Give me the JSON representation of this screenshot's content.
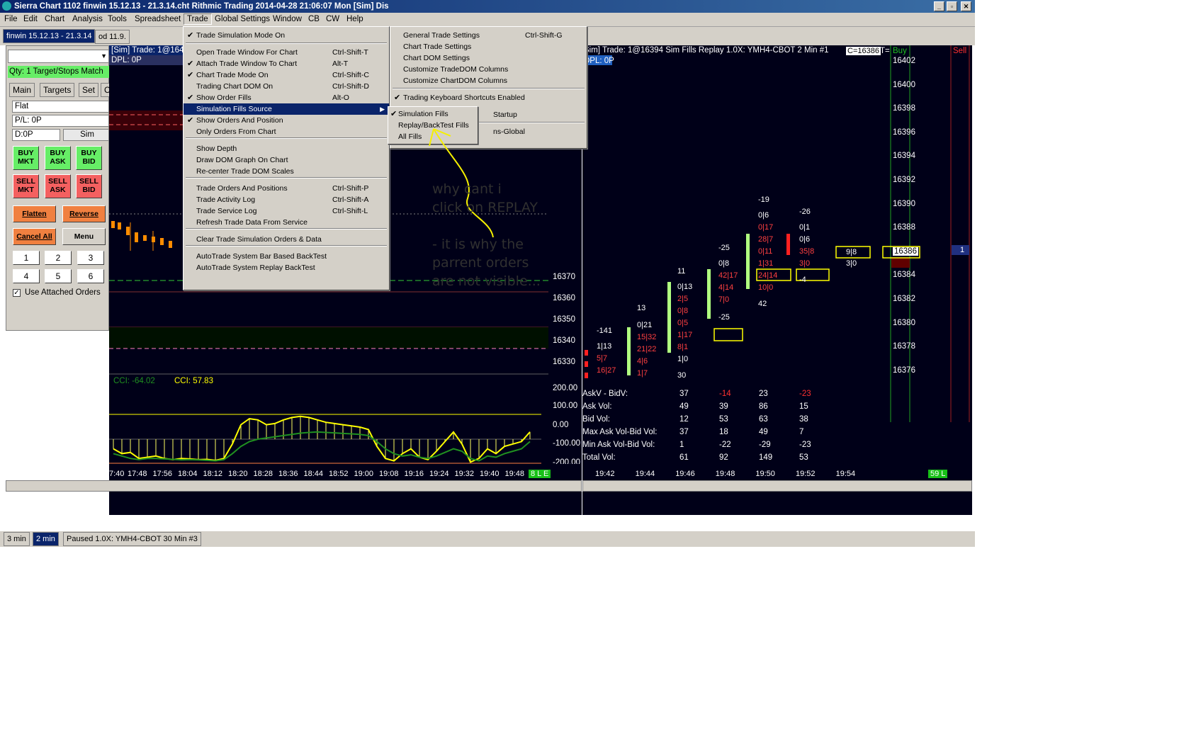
{
  "window": {
    "title": "Sierra Chart 1102 finwin 15.12.13 - 21.3.14.cht  Rithmic Trading 2014-04-28  21:06:07 Mon [Sim]  Dis"
  },
  "menubar": [
    "File",
    "Edit",
    "Chart",
    "Analysis",
    "Tools",
    "Spreadsheet",
    "Trade",
    "Global Settings",
    "Window",
    "CB",
    "CW",
    "Help"
  ],
  "tabs": {
    "chartbook": "finwin 15.12.13 - 21.3.14",
    "second": "od 11.9."
  },
  "trade_window": {
    "qty_label": "Qty: 1 Target/Stops Match",
    "tabs": [
      "Main",
      "Targets",
      "Set",
      "C"
    ],
    "position": "Flat",
    "pl": "P/L: 0P",
    "dpl": "D:0P",
    "mode": "Sim",
    "buy_mkt": "BUY MKT",
    "buy_ask": "BUY ASK",
    "buy_bid": "BUY BID",
    "sell_mkt": "SELL MKT",
    "sell_ask": "SELL ASK",
    "sell_bid": "SELL BID",
    "flatten": "Flatten",
    "reverse": "Reverse",
    "cancel_all": "Cancel All",
    "menu": "Menu",
    "numbers": [
      "1",
      "2",
      "3",
      "4",
      "5",
      "6"
    ],
    "use_attached": "Use Attached Orders"
  },
  "chart1": {
    "header": "[Sim]  Trade: 1@164",
    "dpl": "DPL: 0P",
    "prices": [
      "16370",
      "16360",
      "16350",
      "16340",
      "16330"
    ],
    "cci_label1": "CCI: -64.02",
    "cci_label2": "CCI: 57.83",
    "cci_scale": [
      "200.00",
      "100.00",
      "0.00",
      "-100.00",
      "-200.00"
    ],
    "times": [
      "7:40",
      "17:48",
      "17:56",
      "18:04",
      "18:12",
      "18:20",
      "18:28",
      "18:36",
      "18:44",
      "18:52",
      "19:00",
      "19:08",
      "19:16",
      "19:24",
      "19:32",
      "19:40",
      "19:48"
    ],
    "badge": "8 L E"
  },
  "chart2": {
    "header": "Sim]  Trade: 1@16394  Sim Fills   Replay 1.0X: YMH4-CBOT  2 Min    #1",
    "cbox": "C=16386",
    "t": "T=",
    "buy": "Buy",
    "sell": "Sell",
    "dpl": "DPL: 0P",
    "prices": [
      "16402",
      "16400",
      "16398",
      "16396",
      "16394",
      "16392",
      "16390",
      "16388",
      "16386",
      "16384",
      "16382",
      "16380",
      "16378",
      "16376"
    ],
    "current_price": "16386",
    "sell_qty": "1",
    "stats_labels": [
      "AskV - BidV:",
      "Ask Vol:",
      "Bid Vol:",
      "Max Ask Vol-Bid Vol:",
      "Min Ask Vol-Bid Vol:",
      "Total Vol:"
    ],
    "stats": [
      [
        "37",
        "49",
        "12",
        "37",
        "1",
        "61"
      ],
      [
        "-14",
        "39",
        "53",
        "18",
        "-22",
        "92"
      ],
      [
        "23",
        "86",
        "63",
        "49",
        "-29",
        "149"
      ],
      [
        "-23",
        "15",
        "38",
        "7",
        "-23",
        "53"
      ]
    ],
    "times": [
      "19:42",
      "19:44",
      "19:46",
      "19:48",
      "19:50",
      "19:52",
      "19:54"
    ],
    "badge": "59 L",
    "footprint": {
      "c1": [
        "-141",
        "1|13",
        "5|7",
        "16|27"
      ],
      "c2": [
        "13",
        "0|21",
        "15|32",
        "21|22",
        "4|6",
        "1|7"
      ],
      "c3": [
        "11",
        "0|13",
        "2|5",
        "0|8",
        "0|5",
        "1|17",
        "8|1",
        "1|0",
        "30"
      ],
      "c4": [
        "-25",
        "0|8",
        "42|17",
        "4|14",
        "7|0",
        "-25"
      ],
      "c5": [
        "-19",
        "0|6",
        "0|17",
        "28|7",
        "0|11",
        "1|31",
        "24|14",
        "10|0",
        "42"
      ],
      "c6": [
        "-26",
        "0|1",
        "0|6",
        "35|8",
        "3|0",
        "-4"
      ],
      "c7": [
        "9|8",
        "3|0"
      ]
    }
  },
  "trade_menu": {
    "items": [
      {
        "label": "Trade Simulation Mode On",
        "shortcut": "",
        "checked": true
      },
      {
        "label": "Open Trade Window For Chart",
        "shortcut": "Ctrl-Shift-T",
        "checked": false
      },
      {
        "label": "Attach Trade Window To Chart",
        "shortcut": "Alt-T",
        "checked": true
      },
      {
        "label": "Chart Trade Mode On",
        "shortcut": "Ctrl-Shift-C",
        "checked": true
      },
      {
        "label": "Trading Chart DOM On",
        "shortcut": "Ctrl-Shift-D",
        "checked": false
      },
      {
        "label": "Show Order Fills",
        "shortcut": "Alt-O",
        "checked": true
      },
      {
        "label": "Simulation Fills Source",
        "shortcut": "",
        "checked": false
      },
      {
        "label": "Show Orders And Position",
        "shortcut": "",
        "checked": true
      },
      {
        "label": "Only Orders From Chart",
        "shortcut": "",
        "checked": false
      },
      {
        "label": "Show Depth",
        "shortcut": "",
        "checked": false
      },
      {
        "label": "Draw DOM Graph On Chart",
        "shortcut": "",
        "checked": false
      },
      {
        "label": "Re-center Trade DOM Scales",
        "shortcut": "",
        "checked": false
      },
      {
        "label": "Trade Orders And Positions",
        "shortcut": "Ctrl-Shift-P",
        "checked": false
      },
      {
        "label": "Trade Activity Log",
        "shortcut": "Ctrl-Shift-A",
        "checked": false
      },
      {
        "label": "Trade Service Log",
        "shortcut": "Ctrl-Shift-L",
        "checked": false
      },
      {
        "label": "Refresh Trade Data From Service",
        "shortcut": "",
        "checked": false
      },
      {
        "label": "Clear Trade Simulation Orders & Data",
        "shortcut": "",
        "checked": false
      },
      {
        "label": "AutoTrade System Bar Based BackTest",
        "shortcut": "",
        "checked": false
      },
      {
        "label": "AutoTrade System Replay BackTest",
        "shortcut": "",
        "checked": false
      }
    ]
  },
  "settings_menu": {
    "items": [
      {
        "label": "General Trade Settings",
        "shortcut": "Ctrl-Shift-G"
      },
      {
        "label": "Chart Trade Settings",
        "shortcut": ""
      },
      {
        "label": "Chart DOM Settings",
        "shortcut": ""
      },
      {
        "label": "Customize TradeDOM Columns",
        "shortcut": ""
      },
      {
        "label": "Customize ChartDOM Columns",
        "shortcut": ""
      },
      {
        "label": "Trading Keyboard Shortcuts Enabled",
        "shortcut": ""
      },
      {
        "label": "Startup",
        "shortcut": ""
      },
      {
        "label": "ns-Global",
        "shortcut": ""
      }
    ]
  },
  "fills_submenu": {
    "items": [
      {
        "label": "Simulation Fills",
        "checked": true
      },
      {
        "label": "Replay/BackTest Fills",
        "checked": false
      },
      {
        "label": "All Fills",
        "checked": false
      }
    ]
  },
  "annotation": {
    "line1": "why cant i",
    "line2": "click on REPLAY",
    "line3": "- it is why the",
    "line4": "parrent orders",
    "line5": "are not visible..."
  },
  "bottombar": {
    "tab1": "3 min",
    "tab2": "2 min",
    "status": "Paused 1.0X: YMH4-CBOT  30 Min   #3"
  },
  "colors": {
    "chart_bg": "#000018",
    "menu_highlight": "#0a246a",
    "annotation": "#f5f000",
    "green": "#66ff66",
    "red": "#ff3030"
  }
}
